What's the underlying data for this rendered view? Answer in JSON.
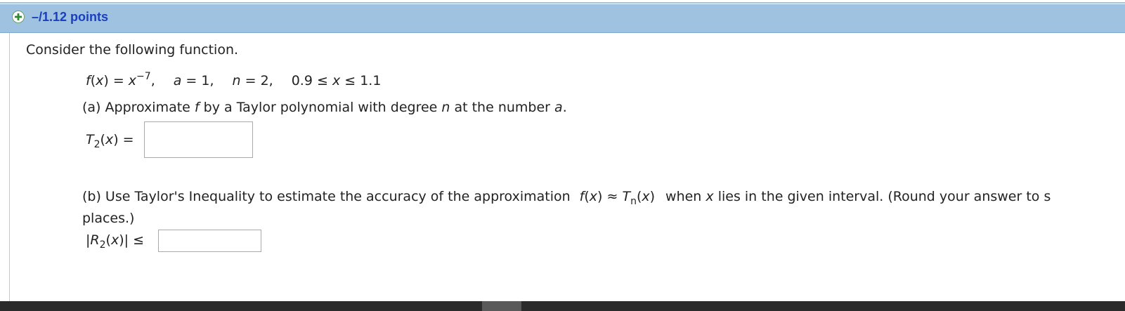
{
  "header": {
    "points": "–/1.12 points",
    "expand_icon": "plus-circle-icon",
    "colors": {
      "bar": "#9ec2e0",
      "points_text": "#1a3fbf",
      "plus": "#2e8b2e"
    }
  },
  "problem": {
    "intro": "Consider the following function.",
    "function": {
      "f_name": "f",
      "x_var": "x",
      "base": "x",
      "exponent": "−7",
      "a_label": "a",
      "a_value": "1",
      "n_label": "n",
      "n_value": "2",
      "interval_low": "0.9",
      "interval_var": "x",
      "interval_high": "1.1"
    },
    "part_a": {
      "question_prefix": "(a) Approximate ",
      "question_f": "f",
      "question_mid": " by a Taylor polynomial with degree ",
      "question_n": "n",
      "question_mid2": " at the number ",
      "question_a": "a",
      "question_end": ".",
      "answer_label_T": "T",
      "answer_label_sub": "2",
      "answer_label_x": "x",
      "answer_value": ""
    },
    "part_b": {
      "line1_prefix": "(b) Use Taylor's Inequality to estimate the accuracy of the approximation",
      "line1_f": "f",
      "line1_x": "x",
      "line1_approx": "≈",
      "line1_T": "T",
      "line1_sub": "n",
      "line1_x2": "x",
      "line1_when": "when",
      "line1_x3": "x",
      "line1_suffix": "lies in the given interval. (Round your answer to s",
      "line2": "places.)",
      "answer_label_R": "R",
      "answer_label_sub": "2",
      "answer_label_x": "x",
      "answer_leq": "≤",
      "answer_value": ""
    }
  }
}
